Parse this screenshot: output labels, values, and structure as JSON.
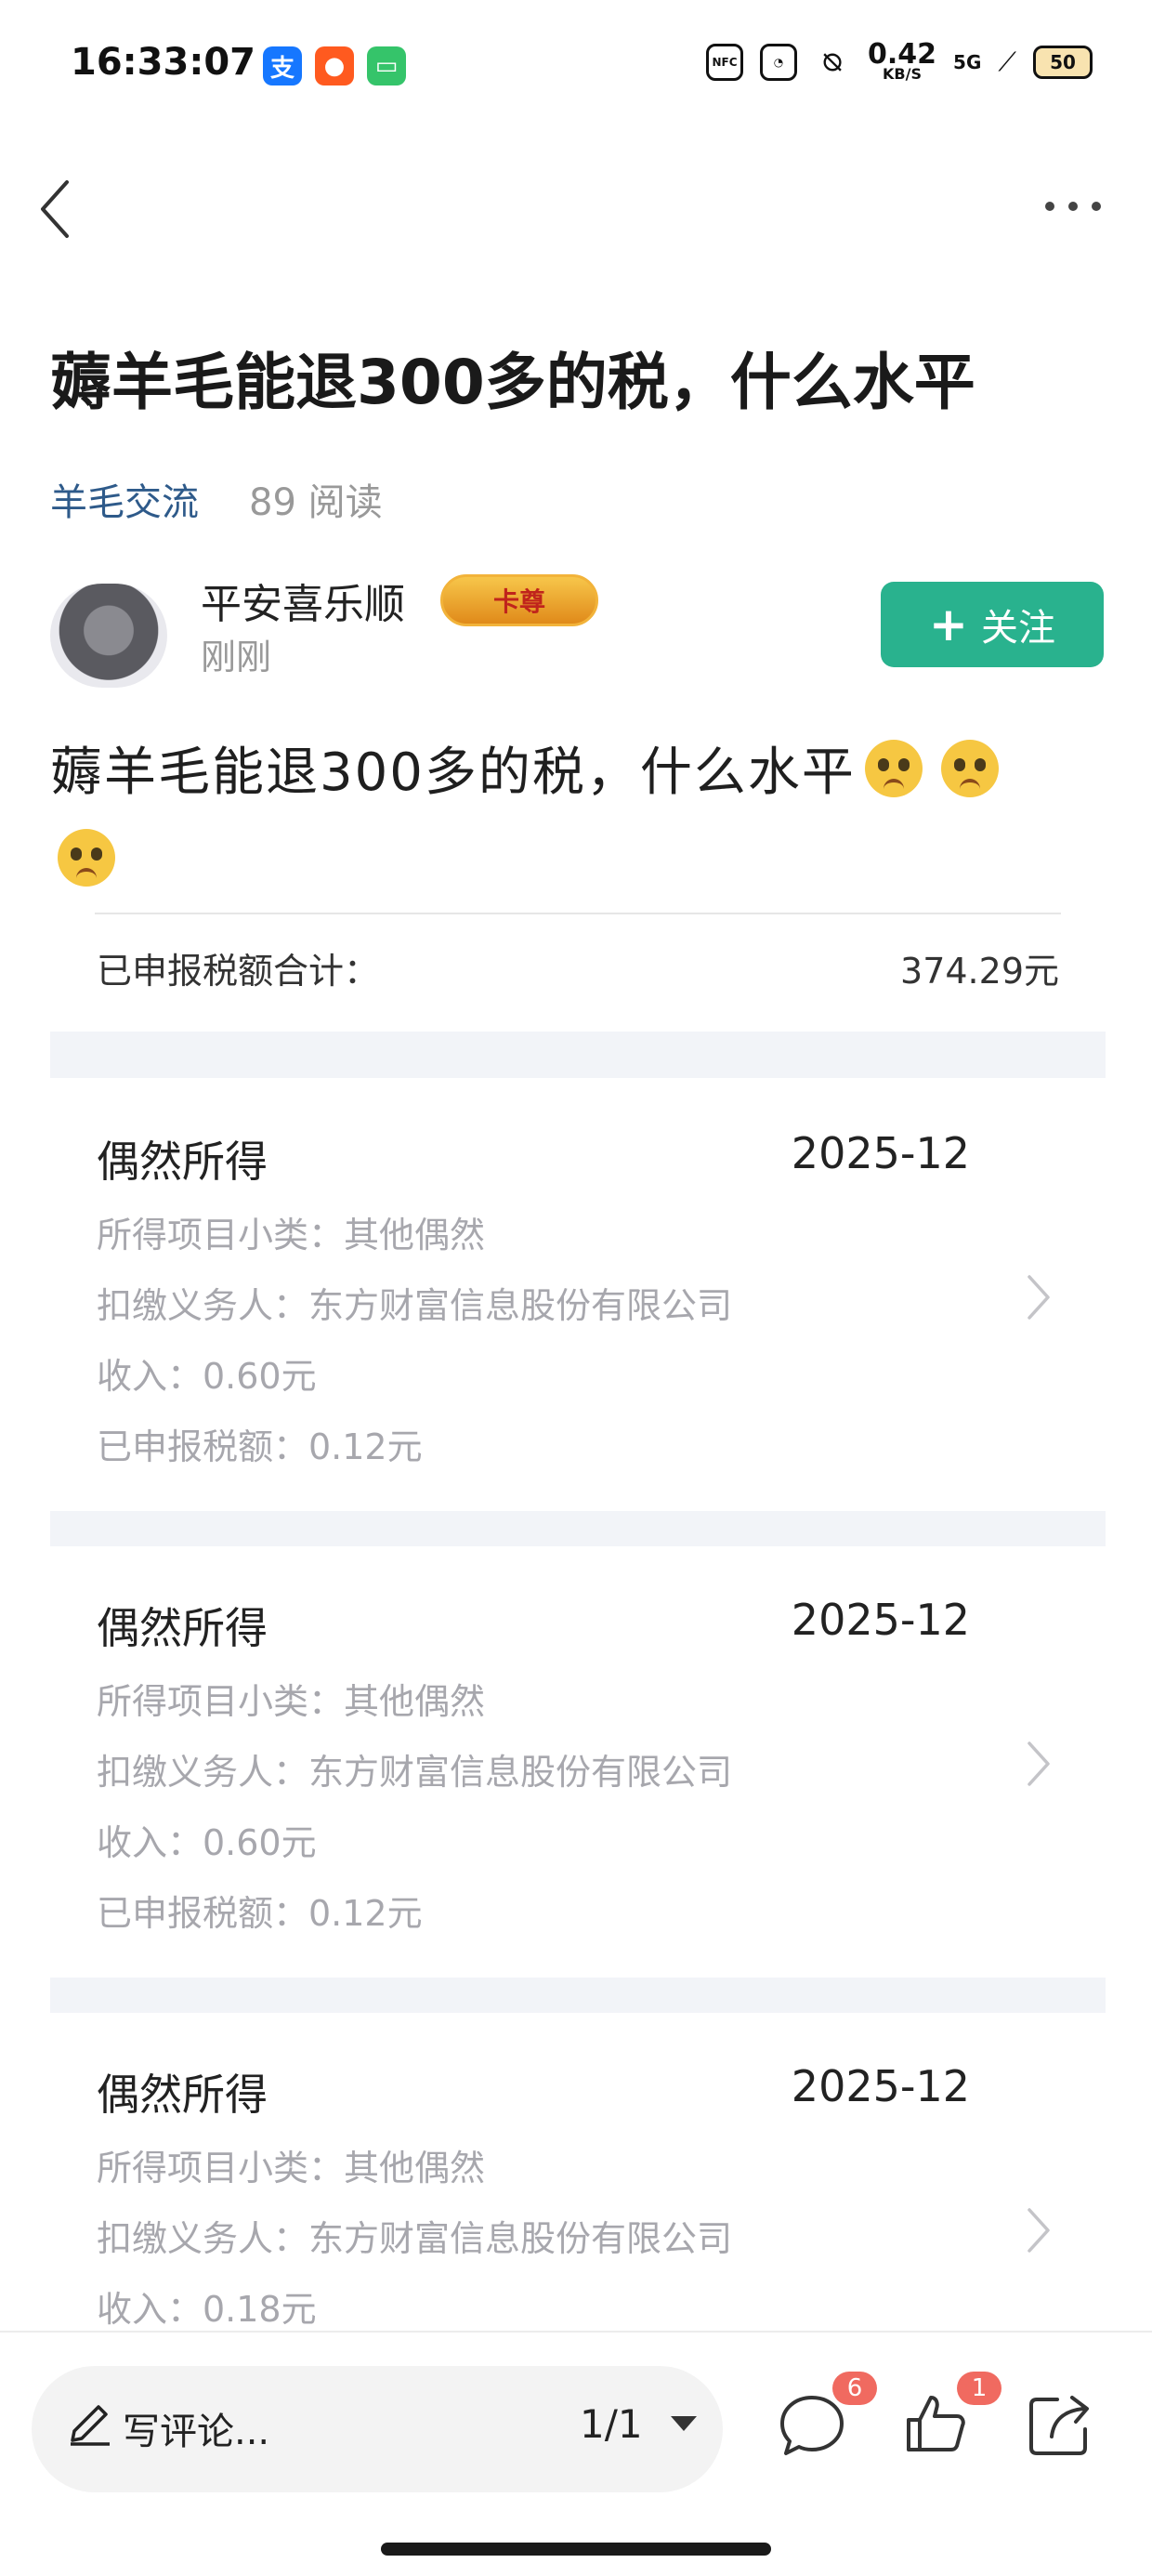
{
  "status": {
    "time": "16:33:07",
    "net_speed": "0.42",
    "net_unit": "KB/S",
    "signal": "5G",
    "battery": "50",
    "nfc": "NFC"
  },
  "post": {
    "title": "薅羊毛能退300多的税，什么水平",
    "category": "羊毛交流",
    "reads": "89 阅读",
    "author": "平安喜乐顺",
    "badge": "卡尊",
    "time": "刚刚",
    "follow_label": "关注",
    "body": "薅羊毛能退300多的税，什么水平"
  },
  "tax": {
    "total_label": "已申报税额合计：",
    "total_value": "374.29元",
    "records": [
      {
        "type": "偶然所得",
        "period": "2025-12",
        "subcategory": "所得项目小类：其他偶然",
        "withholder": "扣缴义务人：东方财富信息股份有限公司",
        "income": "收入：0.60元",
        "tax": "已申报税额：0.12元"
      },
      {
        "type": "偶然所得",
        "period": "2025-12",
        "subcategory": "所得项目小类：其他偶然",
        "withholder": "扣缴义务人：东方财富信息股份有限公司",
        "income": "收入：0.60元",
        "tax": "已申报税额：0.12元"
      },
      {
        "type": "偶然所得",
        "period": "2025-12",
        "subcategory": "所得项目小类：其他偶然",
        "withholder": "扣缴义务人：东方财富信息股份有限公司",
        "income": "收入：0.18元"
      }
    ]
  },
  "bottom_bar": {
    "comment_placeholder": "写评论...",
    "page_indicator": "1/1",
    "comment_count": "6",
    "like_count": "1"
  },
  "colors": {
    "accent": "#29b28e",
    "link": "#2e5a8a",
    "badge_red": "#f06a60"
  }
}
